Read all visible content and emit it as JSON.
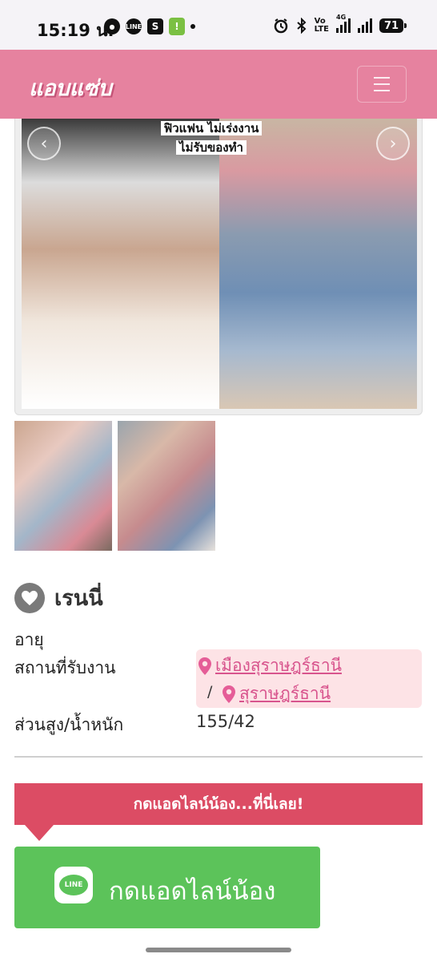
{
  "status_bar": {
    "time": "15:19 น.",
    "line_badge": "LINE",
    "shop_badge": "S",
    "app_badge": "!",
    "network_top": "Vo",
    "network_bottom": "LTE",
    "network_gen": "4G",
    "battery": "71"
  },
  "header": {
    "logo": "แอบแซ่บ"
  },
  "gallery": {
    "overlay_line1": "ฟิวแฟน ไม่เร่งงาน",
    "overlay_line2": "ไม่รับของทำ",
    "prev_label": "‹",
    "next_label": "›"
  },
  "profile": {
    "name": "เรนนี่",
    "age_label": "อายุ",
    "location_label": "สถานที่รับงาน",
    "location_district": "เมืองสุราษฎร์ธานี",
    "location_separator": "/",
    "location_province": "สุราษฎร์ธานี",
    "hw_label": "ส่วนสูง/น้ำหนัก",
    "hw_value": "155/42"
  },
  "cta": {
    "banner": "กดแอดไลน์น้อง...ที่นี่เลย!",
    "line_logo_text": "LINE",
    "button_label": "กดแอดไลน์น้อง"
  },
  "colors": {
    "header_bg": "#e6829f",
    "accent_pink": "#d8548d",
    "banner_red": "#dc4c64",
    "line_green": "#5cc35a"
  }
}
